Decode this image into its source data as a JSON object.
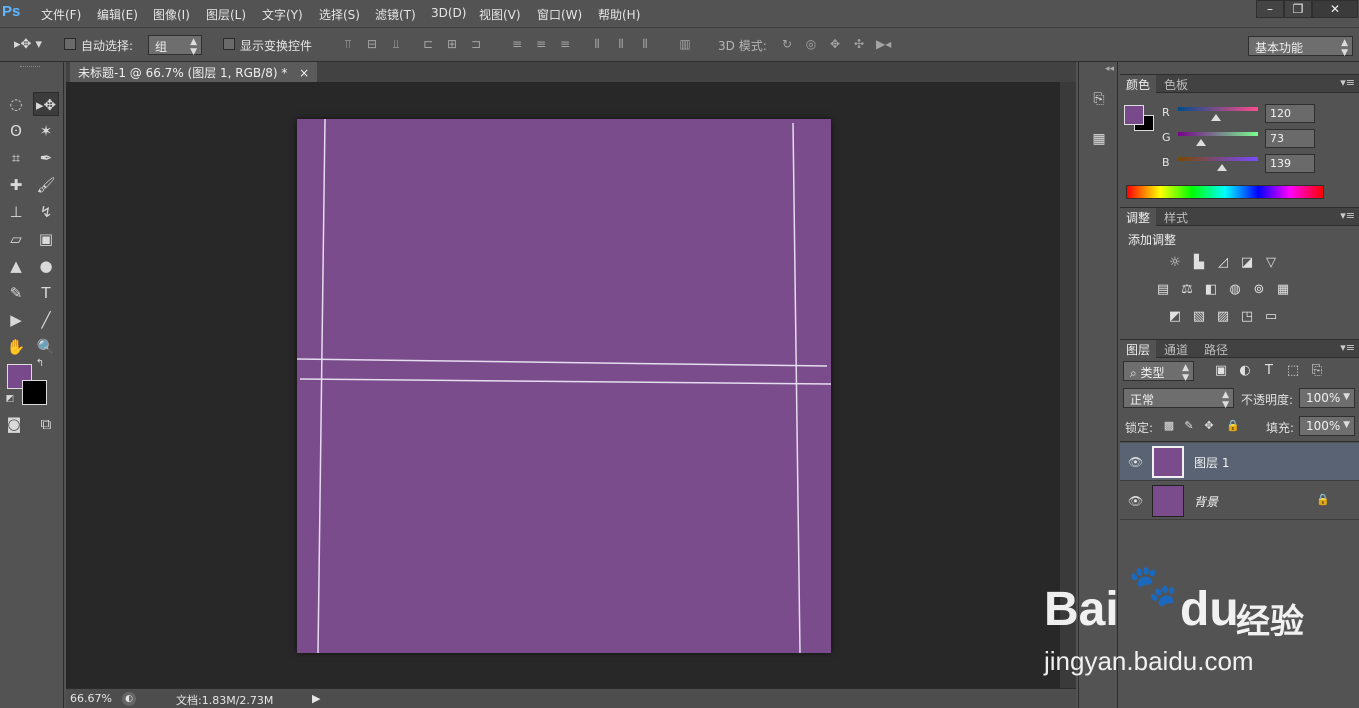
{
  "app": {
    "logo": "Ps"
  },
  "menu": [
    "文件(F)",
    "编辑(E)",
    "图像(I)",
    "图层(L)",
    "文字(Y)",
    "选择(S)",
    "滤镜(T)",
    "3D(D)",
    "视图(V)",
    "窗口(W)",
    "帮助(H)"
  ],
  "window_controls": {
    "minimize": "–",
    "restore": "❐",
    "close": "✕"
  },
  "options": {
    "auto_select_label": "自动选择:",
    "auto_select_value": "组",
    "show_transform_label": "显示变换控件",
    "mode_3d_label": "3D 模式:",
    "workspace": "基本功能"
  },
  "document": {
    "tab_title": "未标题-1 @ 66.7% (图层 1, RGB/8) *",
    "close": "×",
    "background_color": "#7a4c8c",
    "guide_color": "#e6dcef"
  },
  "status": {
    "zoom": "66.67%",
    "doc_info": "文档:1.83M/2.73M"
  },
  "color_panel": {
    "tabs": [
      "颜色",
      "色板"
    ],
    "channels": [
      {
        "label": "R",
        "value": "120",
        "fraction": 0.47
      },
      {
        "label": "G",
        "value": "73",
        "fraction": 0.29
      },
      {
        "label": "B",
        "value": "139",
        "fraction": 0.55
      }
    ],
    "foreground": "#78498b",
    "background": "#000000"
  },
  "adjustments_panel": {
    "tabs": [
      "调整",
      "样式"
    ],
    "title": "添加调整",
    "icons": [
      [
        "brightness-contrast-icon",
        "levels-icon",
        "curves-icon",
        "exposure-icon",
        "vibrance-icon"
      ],
      [
        "hue-saturation-icon",
        "color-balance-icon",
        "black-white-icon",
        "photo-filter-icon",
        "channel-mixer-icon",
        "color-lookup-icon"
      ],
      [
        "invert-icon",
        "posterize-icon",
        "threshold-icon",
        "selective-color-icon",
        "gradient-map-icon"
      ]
    ]
  },
  "layers_panel": {
    "tabs": [
      "图层",
      "通道",
      "路径"
    ],
    "filter_kind": "类型",
    "blend_mode": "正常",
    "opacity_label": "不透明度:",
    "opacity_value": "100%",
    "lock_label": "锁定:",
    "fill_label": "填充:",
    "fill_value": "100%",
    "layers": [
      {
        "name": "图层 1",
        "selected": true,
        "locked": false
      },
      {
        "name": "背景",
        "selected": false,
        "locked": true
      }
    ]
  },
  "watermark": {
    "brand_left": "Bai",
    "brand_right": "du",
    "brand_suffix": "经验",
    "url": "jingyan.baidu.com"
  }
}
